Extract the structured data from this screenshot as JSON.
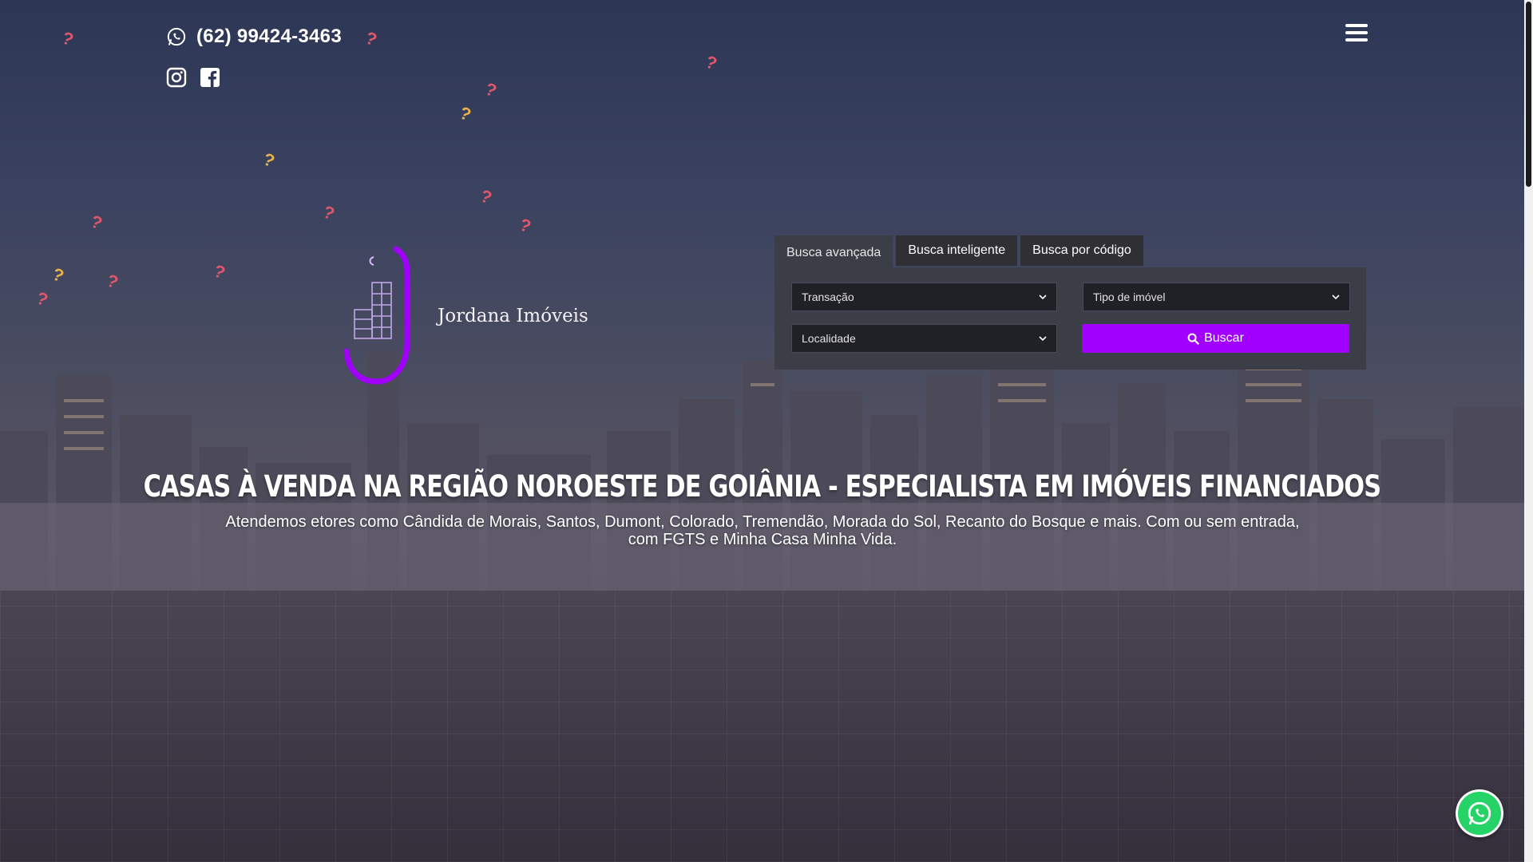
{
  "header": {
    "phone": "(62) 99424-3463",
    "whatsapp_icon": "whatsapp-icon",
    "social_icons": [
      "instagram-icon",
      "facebook-icon"
    ],
    "menu_icon": "hamburger-menu-icon"
  },
  "logo": {
    "text": "Jordana Imóveis"
  },
  "search": {
    "tabs": [
      {
        "label": "Busca avançada",
        "active": true
      },
      {
        "label": "Busca inteligente",
        "active": false
      },
      {
        "label": "Busca por código",
        "active": false
      }
    ],
    "transacao": "Transação",
    "tipo_imovel": "Tipo de imóvel",
    "localidade": "Localidade",
    "buscar": "Buscar"
  },
  "hero": {
    "headline": "CASAS À VENDA NA REGIÃO NOROESTE DE GOIÂNIA - ESPECIALISTA EM IMÓVEIS FINANCIADOS",
    "subtitle_line1": "Atendemos etores como Cândida de Morais, Santos, Dumont, Colorado, Tremendão, Morada do Sol, Recanto do Bosque e mais. Com ou sem entrada,",
    "subtitle_line2": "com FGTS e Minha Casa Minha Vida."
  },
  "colors": {
    "accent": "#a100ff",
    "whatsapp": "#25d366",
    "panel": "#3b3d47"
  }
}
